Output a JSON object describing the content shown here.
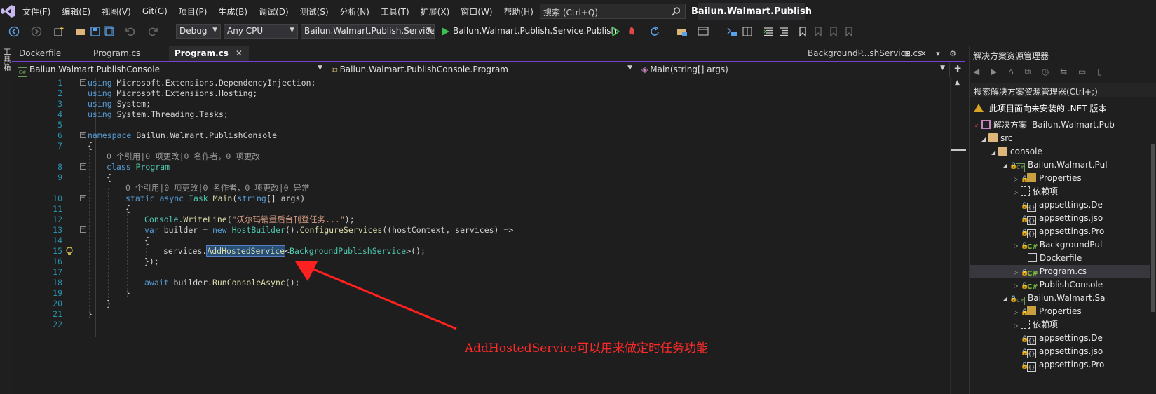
{
  "menu": [
    "文件(F)",
    "编辑(E)",
    "视图(V)",
    "Git(G)",
    "项目(P)",
    "生成(B)",
    "调试(D)",
    "测试(S)",
    "分析(N)",
    "工具(T)",
    "扩展(X)",
    "窗口(W)",
    "帮助(H)"
  ],
  "search": {
    "placeholder": "搜索 (Ctrl+Q)"
  },
  "window_title": "Bailun.Walmart.Publish",
  "toolbar": {
    "config": "Debug",
    "platform": "Any CPU",
    "startup_project": "Bailun.Walmart.Publish.Service.F",
    "run_target": "Bailun.Walmart.Publish.Service.Publish"
  },
  "left_strip": {
    "label": "工具箱"
  },
  "tabs": [
    {
      "label": "Dockerfile",
      "active": false
    },
    {
      "label": "Program.cs",
      "active": false
    },
    {
      "label": "Program.cs",
      "active": true,
      "close": "✕"
    },
    {
      "label": "BackgroundP...shService.cs",
      "active": false
    }
  ],
  "navbar": {
    "project": "Bailun.Walmart.PublishConsole",
    "type": "Bailun.Walmart.PublishConsole.Program",
    "member": "Main(string[] args)",
    "cs_glyph": "C#"
  },
  "code": {
    "line_numbers": [
      "1",
      "2",
      "3",
      "4",
      "5",
      "6",
      "7",
      "8",
      "9",
      "10",
      "11",
      "12",
      "13",
      "14",
      "15",
      "16",
      "17",
      "18",
      "19",
      "20",
      "21",
      "22"
    ],
    "using1": "Microsoft.Extensions.DependencyInjection;",
    "using2": "Microsoft.Extensions.Hosting;",
    "using3": "System;",
    "using4": "System.Threading.Tasks;",
    "kw_using": "using",
    "kw_namespace": "namespace",
    "ns_name": " Bailun.Walmart.PublishConsole",
    "brace_open": "{",
    "brace_close": "}",
    "lens_class": "0 个引用|0 项更改|0 名作者，0 项更改",
    "kw_class": "class",
    "class_name": " Program",
    "lens_method": "0 个引用|0 项更改|0 名作者，0 项更改|0 异常",
    "kw_static": "static",
    "kw_async": " async",
    "ty_task": " Task",
    "mt_main": " Main",
    "paren_open": "(",
    "kw_string": "string",
    "args": "[] args)",
    "ty_console": "Console",
    "dot": ".",
    "mt_writeline": "WriteLine",
    "str_msg": "\"沃尔玛销量后台刊登任务...\"",
    "end_call": ");",
    "kw_var": "var",
    "builder_eq": " builder = ",
    "kw_new": "new",
    "ty_hostbuilder": " HostBuilder",
    "call_empty": "().",
    "mt_configure": "ConfigureServices",
    "lambda_params": "((hostContext, services) =>",
    "services_dot": "services.",
    "mt_addhosted": "AddHostedService",
    "lt": "<",
    "ty_bgservice": "BackgroundPublishService",
    "gt": ">",
    "end_generic": "();",
    "close_lambda": "});",
    "kw_await": "await",
    "await_rest": " builder.",
    "mt_runconsole": "RunConsoleAsync",
    "end_await": "();"
  },
  "annotation": "AddHostedService可以用来做定时任务功能",
  "annotation_color": "#ff2a2a",
  "accent_color": "#7a3fd6",
  "solution_explorer": {
    "title": "解决方案资源管理器",
    "search_placeholder": "搜索解决方案资源管理器(Ctrl+;)",
    "warning": "此项目面向未安装的 .NET 版本",
    "items": [
      {
        "label": "解决方案 'Bailun.Walmart.Pub"
      },
      {
        "label": "src"
      },
      {
        "label": "console"
      },
      {
        "label": "Bailun.Walmart.Pul"
      },
      {
        "label": "Properties"
      },
      {
        "label": "依赖项"
      },
      {
        "label": "appsettings.De"
      },
      {
        "label": "appsettings.jso"
      },
      {
        "label": "appsettings.Pro"
      },
      {
        "label": "BackgroundPul"
      },
      {
        "label": "Dockerfile"
      },
      {
        "label": "Program.cs"
      },
      {
        "label": "PublishConsole"
      },
      {
        "label": "Bailun.Walmart.Sa"
      },
      {
        "label": "Properties"
      },
      {
        "label": "依赖项"
      },
      {
        "label": "appsettings.De"
      },
      {
        "label": "appsettings.jso"
      },
      {
        "label": "appsettings.Pro"
      }
    ]
  }
}
